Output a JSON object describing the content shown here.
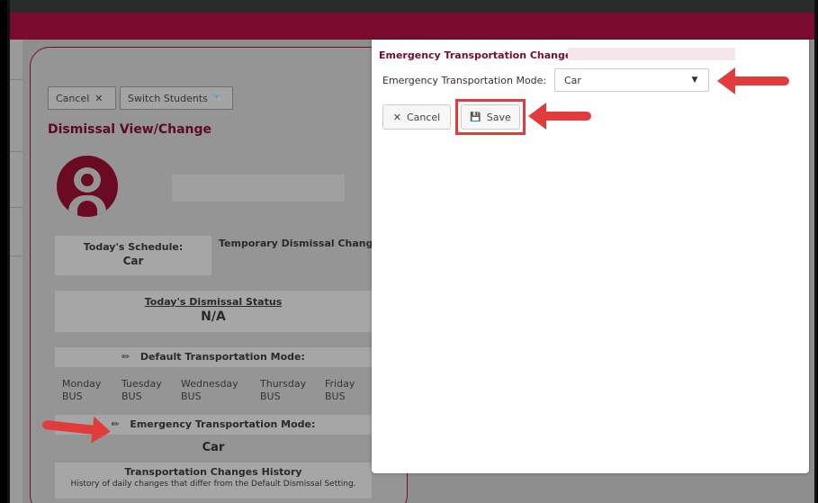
{
  "toolbar": {
    "cancel_label": "Cancel",
    "cancel_glyph": "✕",
    "switch_label": "Switch Students",
    "switch_glyph": "🔧"
  },
  "page_title": "Dismissal View/Change",
  "schedule": {
    "label": "Today's Schedule:",
    "value": "Car",
    "temp_changes": "Temporary Dismissal Changes"
  },
  "status": {
    "label": "Today's Dismissal Status",
    "value": "N/A"
  },
  "default_mode": {
    "label": "Default Transportation Mode:",
    "days": [
      {
        "day": "Monday",
        "mode": "BUS"
      },
      {
        "day": "Tuesday",
        "mode": "BUS"
      },
      {
        "day": "Wednesday",
        "mode": "BUS"
      },
      {
        "day": "Thursday",
        "mode": "BUS"
      },
      {
        "day": "Friday",
        "mode": "BUS"
      }
    ]
  },
  "emergency_mode": {
    "label": "Emergency Transportation Mode:",
    "value": "Car"
  },
  "history": {
    "title": "Transportation Changes History",
    "desc": "History of daily changes that differ from the Default Dismissal Setting."
  },
  "dialog": {
    "title": "Emergency Transportation Change for",
    "mode_label": "Emergency Transportation Mode:",
    "mode_value": "Car",
    "caret": "▼",
    "cancel_label": "Cancel",
    "cancel_glyph": "✕",
    "save_label": "Save",
    "save_glyph": "💾"
  },
  "colors": {
    "brand": "#7a0b2f",
    "annotation": "#e23b3b"
  }
}
